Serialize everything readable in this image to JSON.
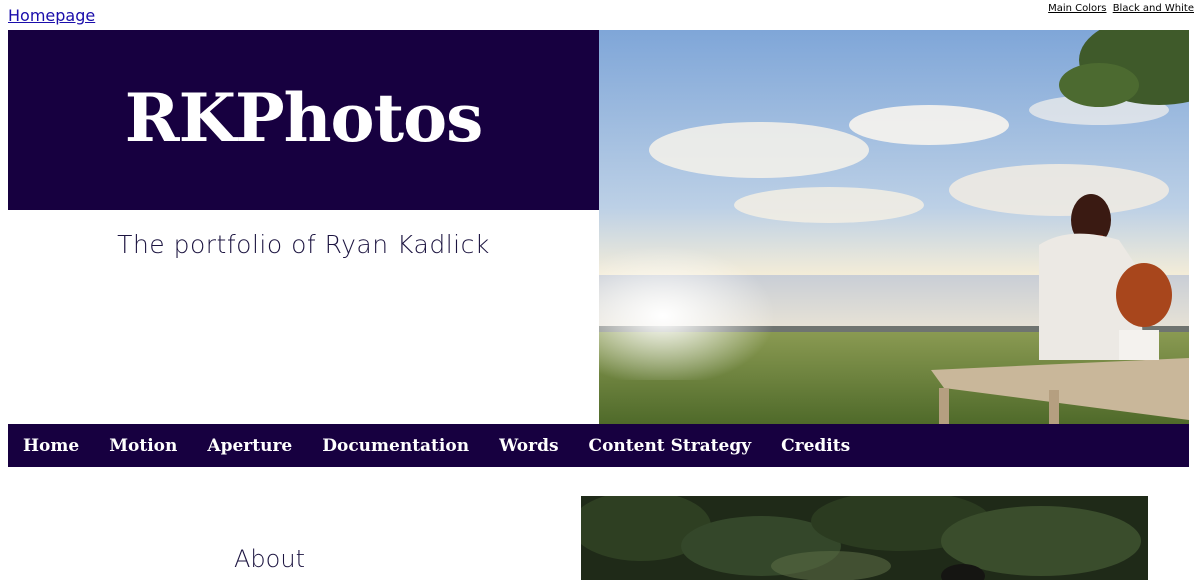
{
  "skip_link": "Homepage",
  "theme_switch": {
    "main_colors": "Main Colors",
    "black_and_white": "Black and White"
  },
  "banner": {
    "title": "RKPhotos",
    "tagline": "The portfolio of Ryan Kadlick"
  },
  "colors": {
    "brand": "#170040",
    "link": "#1a0dab"
  },
  "nav": {
    "items": [
      {
        "label": "Home"
      },
      {
        "label": "Motion"
      },
      {
        "label": "Aperture"
      },
      {
        "label": "Documentation"
      },
      {
        "label": "Words"
      },
      {
        "label": "Content Strategy"
      },
      {
        "label": "Credits"
      }
    ]
  },
  "main": {
    "about_heading": "About"
  }
}
